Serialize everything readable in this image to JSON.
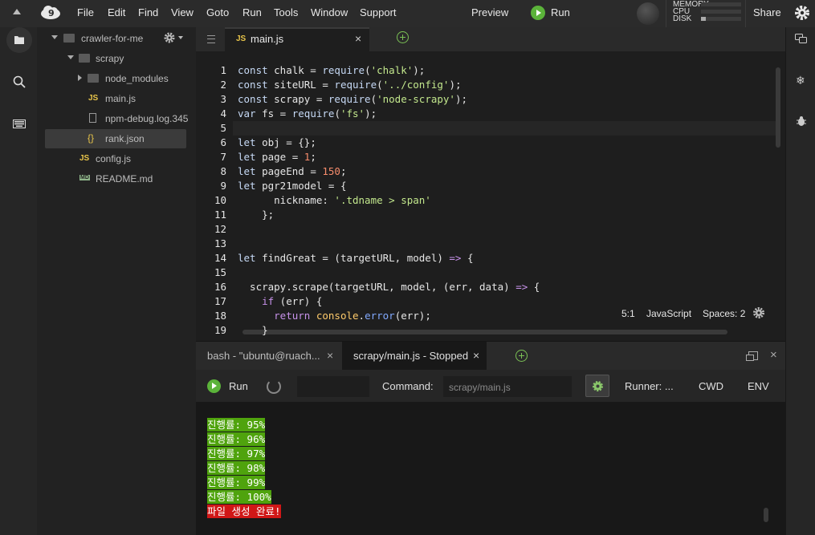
{
  "menubar": {
    "items": [
      "File",
      "Edit",
      "Find",
      "View",
      "Goto",
      "Run",
      "Tools",
      "Window",
      "Support"
    ],
    "preview_label": "Preview",
    "run_label": "Run",
    "stats": [
      "MEMORY",
      "CPU",
      "DISK"
    ],
    "share_label": "Share"
  },
  "tree": {
    "root": "crawler-for-me",
    "items": [
      {
        "name": "scrapy",
        "type": "folder"
      },
      {
        "name": "node_modules",
        "type": "folder"
      },
      {
        "name": "main.js",
        "type": "js"
      },
      {
        "name": "npm-debug.log.345",
        "type": "log"
      },
      {
        "name": "rank.json",
        "type": "json"
      },
      {
        "name": "config.js",
        "type": "js"
      },
      {
        "name": "README.md",
        "type": "md"
      }
    ],
    "js_badge": "JS",
    "md_badge": "MD",
    "json_badge": "{}"
  },
  "editor": {
    "tab_label": "main.js",
    "tab_badge": "JS",
    "line_numbers": [
      "1",
      "2",
      "3",
      "4",
      "5",
      "6",
      "7",
      "8",
      "9",
      "10",
      "11",
      "12",
      "13",
      "14",
      "15",
      "16",
      "17",
      "18",
      "19"
    ],
    "status": {
      "position": "5:1",
      "language": "JavaScript",
      "spaces": "Spaces: 2"
    }
  },
  "terminal": {
    "tabs": [
      {
        "label": "bash - \"ubuntu@ruach...",
        "close": "×"
      },
      {
        "label": "scrapy/main.js - Stopped",
        "close": "×"
      }
    ],
    "run_label": "Run",
    "command_label": "Command:",
    "command_value": "scrapy/main.js",
    "runner_label": "Runner: ...",
    "cwd_label": "CWD",
    "env_label": "ENV",
    "lines": [
      "진행률: 95%",
      "진행률: 96%",
      "진행률: 97%",
      "진행률: 98%",
      "진행률: 99%",
      "진행률: 100%"
    ],
    "done_line": "파일 생성 완료!"
  }
}
